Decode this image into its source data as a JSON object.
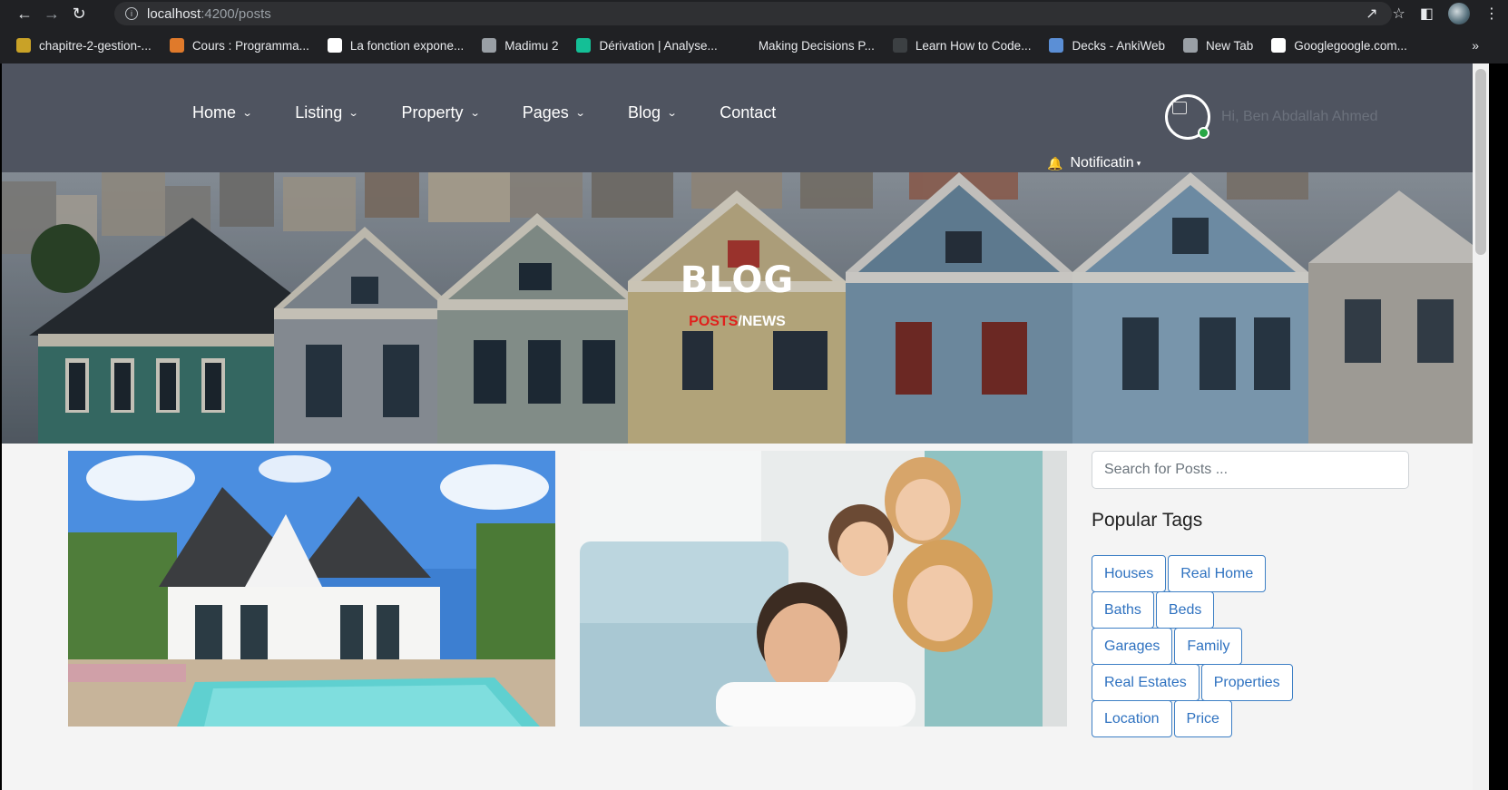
{
  "browser": {
    "url_host": "localhost",
    "url_port_path": ":4200/posts",
    "bookmarks": [
      {
        "label": "chapitre-2-gestion-...",
        "icon": "figure-icon",
        "color": "#c9a227"
      },
      {
        "label": "Cours : Programma...",
        "icon": "openclassrooms-icon",
        "color": "#e07a2b"
      },
      {
        "label": "La fonction expone...",
        "icon": "k-icon",
        "color": "#ffffff"
      },
      {
        "label": "Madimu 2",
        "icon": "globe-icon",
        "color": "#9aa0a6"
      },
      {
        "label": "Dérivation | Analyse...",
        "icon": "khan-icon",
        "color": "#14bf96"
      },
      {
        "label": "Making Decisions P...",
        "icon": "blank-icon",
        "color": "#202124"
      },
      {
        "label": "Learn How to Code...",
        "icon": "doc-icon",
        "color": "#3c4043"
      },
      {
        "label": "Decks - AnkiWeb",
        "icon": "anki-icon",
        "color": "#5b8fd6"
      },
      {
        "label": "New Tab",
        "icon": "globe-icon",
        "color": "#9aa0a6"
      },
      {
        "label": "Googlegoogle.com...",
        "icon": "google-icon",
        "color": "#ffffff"
      }
    ],
    "more": "»"
  },
  "header": {
    "menu": [
      {
        "label": "Home",
        "has_dropdown": true
      },
      {
        "label": "Listing",
        "has_dropdown": true
      },
      {
        "label": "Property",
        "has_dropdown": true
      },
      {
        "label": "Pages",
        "has_dropdown": true
      },
      {
        "label": "Blog",
        "has_dropdown": true
      },
      {
        "label": "Contact",
        "has_dropdown": false
      }
    ],
    "user_greeting": "Hi, Ben Abdallah Ahmed",
    "notification_label": "Notificatin"
  },
  "hero": {
    "title": "BLOG",
    "crumb_active": "POSTS",
    "crumb_rest": "/NEWS"
  },
  "sidebar": {
    "search_placeholder": "Search for Posts ...",
    "tags_title": "Popular Tags",
    "tag_rows": [
      [
        "Houses",
        "Real Home"
      ],
      [
        "Baths",
        "Beds"
      ],
      [
        "Garages",
        "Family"
      ],
      [
        "Real Estates",
        "Properties"
      ],
      [
        "Location",
        "Price"
      ]
    ]
  },
  "colors": {
    "header_bg": "#4f5460",
    "accent_red": "#e0201c",
    "tag_blue": "#2f72c0",
    "online_green": "#28a745"
  }
}
